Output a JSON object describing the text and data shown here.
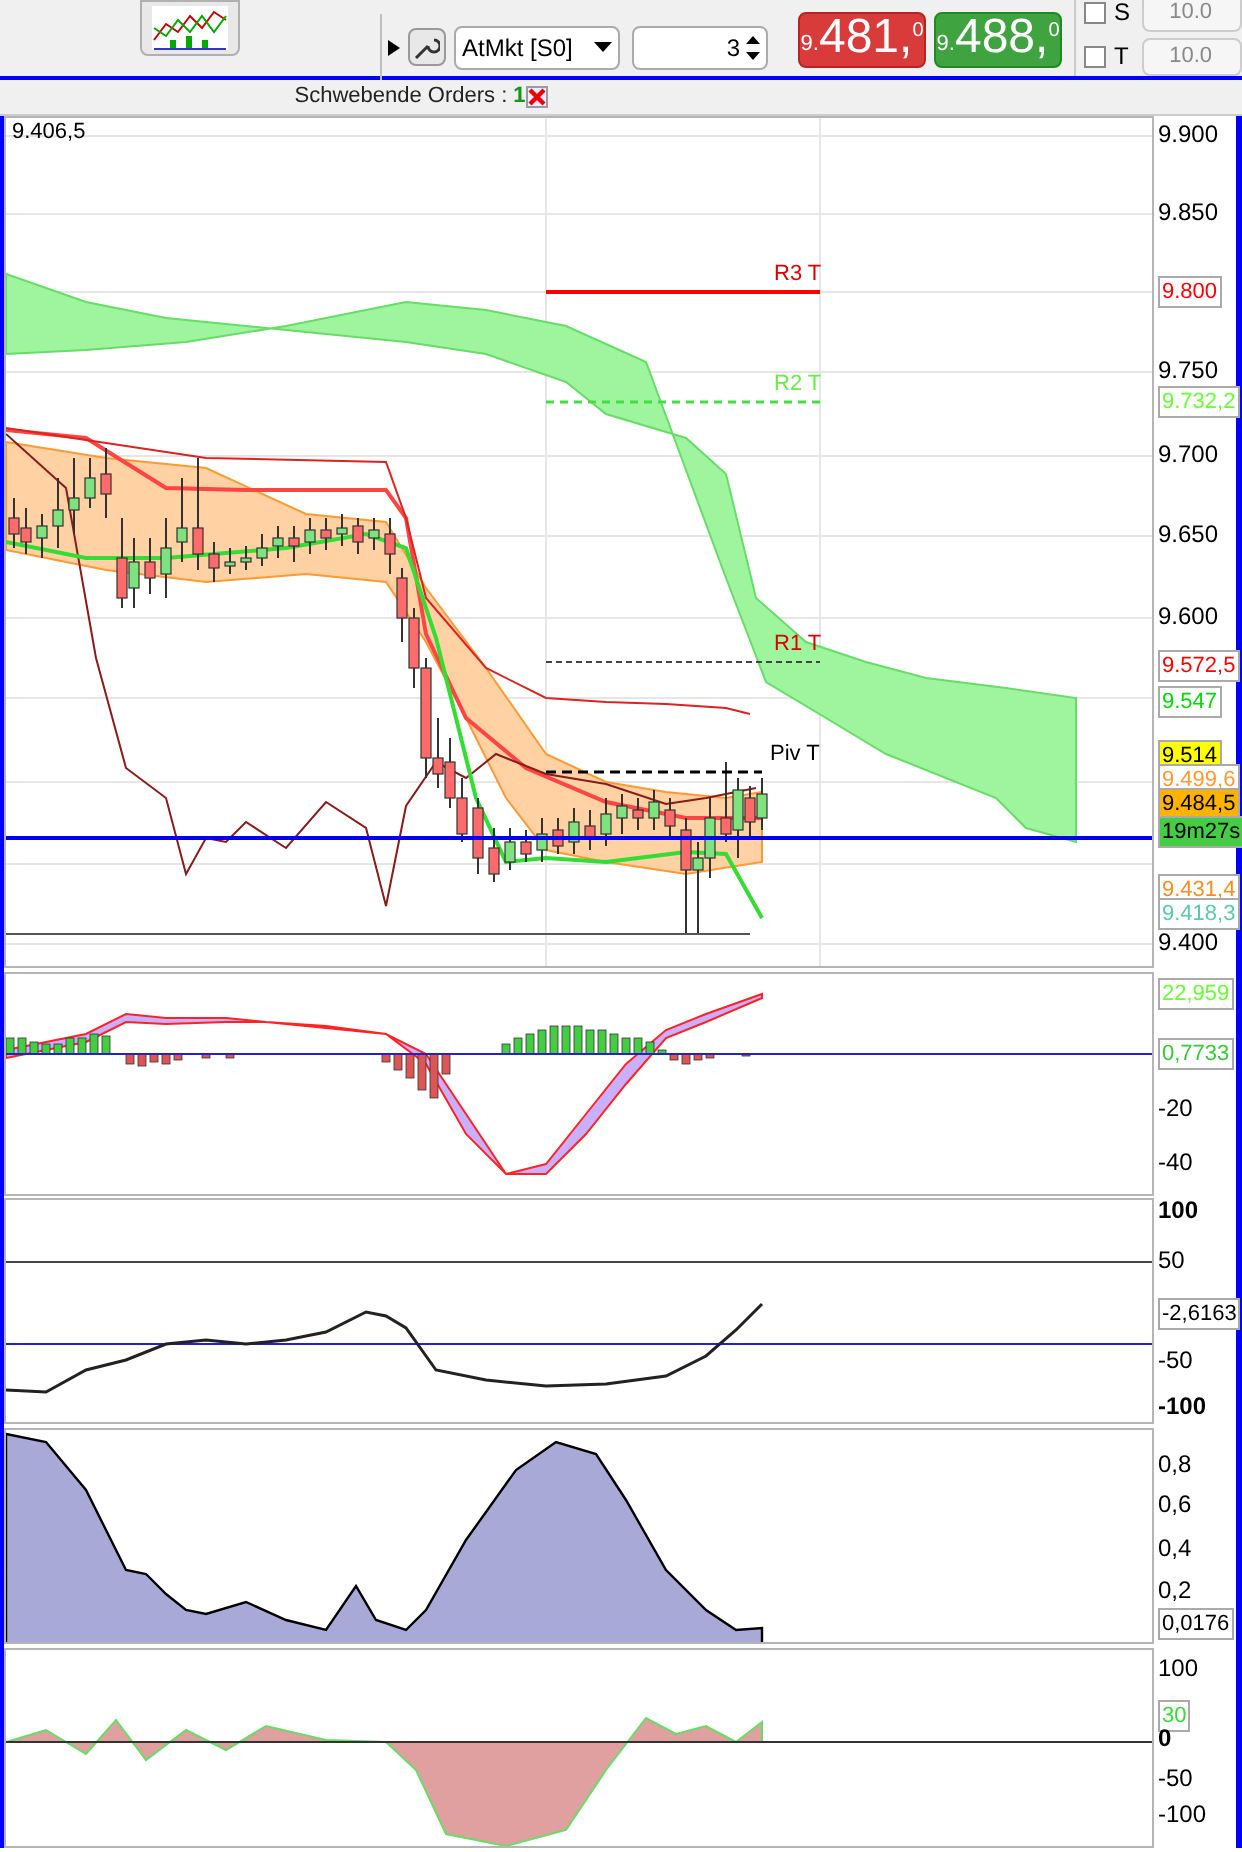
{
  "toolbar": {
    "order_type": "AtMkt [S0]",
    "quantity": "3",
    "prices": [
      {
        "kind": "sell",
        "prefix": "9.",
        "main": "481,",
        "suffix": "0"
      },
      {
        "kind": "buy",
        "prefix": "9.",
        "main": "488,",
        "suffix": "0"
      }
    ],
    "stops": [
      {
        "label": "S",
        "checked": false,
        "value": "10.0",
        "disabled": true
      },
      {
        "label": "T",
        "checked": false,
        "value": "10.0",
        "disabled": true
      }
    ]
  },
  "pending_orders": {
    "label": "Schwebende Orders :",
    "count": "1"
  },
  "panels": [
    {
      "kind": "price",
      "chart_labels": [
        "9.406,5",
        "R3 T",
        "R2 T",
        "R1 T",
        "Piv T"
      ],
      "axis": [
        {
          "text": "9.900",
          "kind": "tick"
        },
        {
          "text": "9.850",
          "kind": "tick"
        },
        {
          "text": "9.800",
          "kind": "badge",
          "color": "#ff0000"
        },
        {
          "text": "9.750",
          "kind": "tick"
        },
        {
          "text": "9.732,2",
          "kind": "badge",
          "color": "#66ff33"
        },
        {
          "text": "9.700",
          "kind": "tick"
        },
        {
          "text": "9.650",
          "kind": "tick"
        },
        {
          "text": "9.600",
          "kind": "tick"
        },
        {
          "text": "9.572,5",
          "kind": "badge",
          "color": "#ff0000"
        },
        {
          "text": "9.547",
          "kind": "badge",
          "color": "#00dd00"
        },
        {
          "text": "9.514",
          "kind": "fill",
          "color": "#ffff00"
        },
        {
          "text": "9.499,6",
          "kind": "badge",
          "color": "#ff9933"
        },
        {
          "text": "9.484,5",
          "kind": "fill",
          "color": "#ffb300"
        },
        {
          "text": "19m27s",
          "kind": "fill",
          "color": "#44cc44"
        },
        {
          "text": "9.431,4",
          "kind": "badge",
          "color": "#ff8c1a"
        },
        {
          "text": "9.418,3",
          "kind": "badge",
          "color": "#55ccaa"
        },
        {
          "text": "9.400",
          "kind": "tick"
        }
      ]
    },
    {
      "kind": "macd",
      "axis": [
        {
          "text": "22,959",
          "kind": "badge",
          "color": "#66ff33"
        },
        {
          "text": "0,7733",
          "kind": "badge",
          "color": "#33cc33"
        },
        {
          "text": "-20",
          "kind": "tick"
        },
        {
          "text": "-40",
          "kind": "tick"
        }
      ]
    },
    {
      "kind": "cci",
      "axis": [
        {
          "text": "100",
          "kind": "bold"
        },
        {
          "text": "50",
          "kind": "tick"
        },
        {
          "text": "-2,6163",
          "kind": "badge",
          "color": "#000000"
        },
        {
          "text": "-50",
          "kind": "tick"
        },
        {
          "text": "-100",
          "kind": "bold"
        }
      ]
    },
    {
      "kind": "oscillator",
      "axis": [
        {
          "text": "0,8",
          "kind": "tick"
        },
        {
          "text": "0,6",
          "kind": "tick"
        },
        {
          "text": "0,4",
          "kind": "tick"
        },
        {
          "text": "0,2",
          "kind": "tick"
        },
        {
          "text": "0,0176",
          "kind": "badge",
          "color": "#000000"
        }
      ]
    },
    {
      "kind": "momentum",
      "axis": [
        {
          "text": "100",
          "kind": "tick"
        },
        {
          "text": "30",
          "kind": "badge",
          "color": "#33dd33"
        },
        {
          "text": "0",
          "kind": "bold"
        },
        {
          "text": "-50",
          "kind": "tick"
        },
        {
          "text": "-100",
          "kind": "tick"
        }
      ]
    }
  ]
}
